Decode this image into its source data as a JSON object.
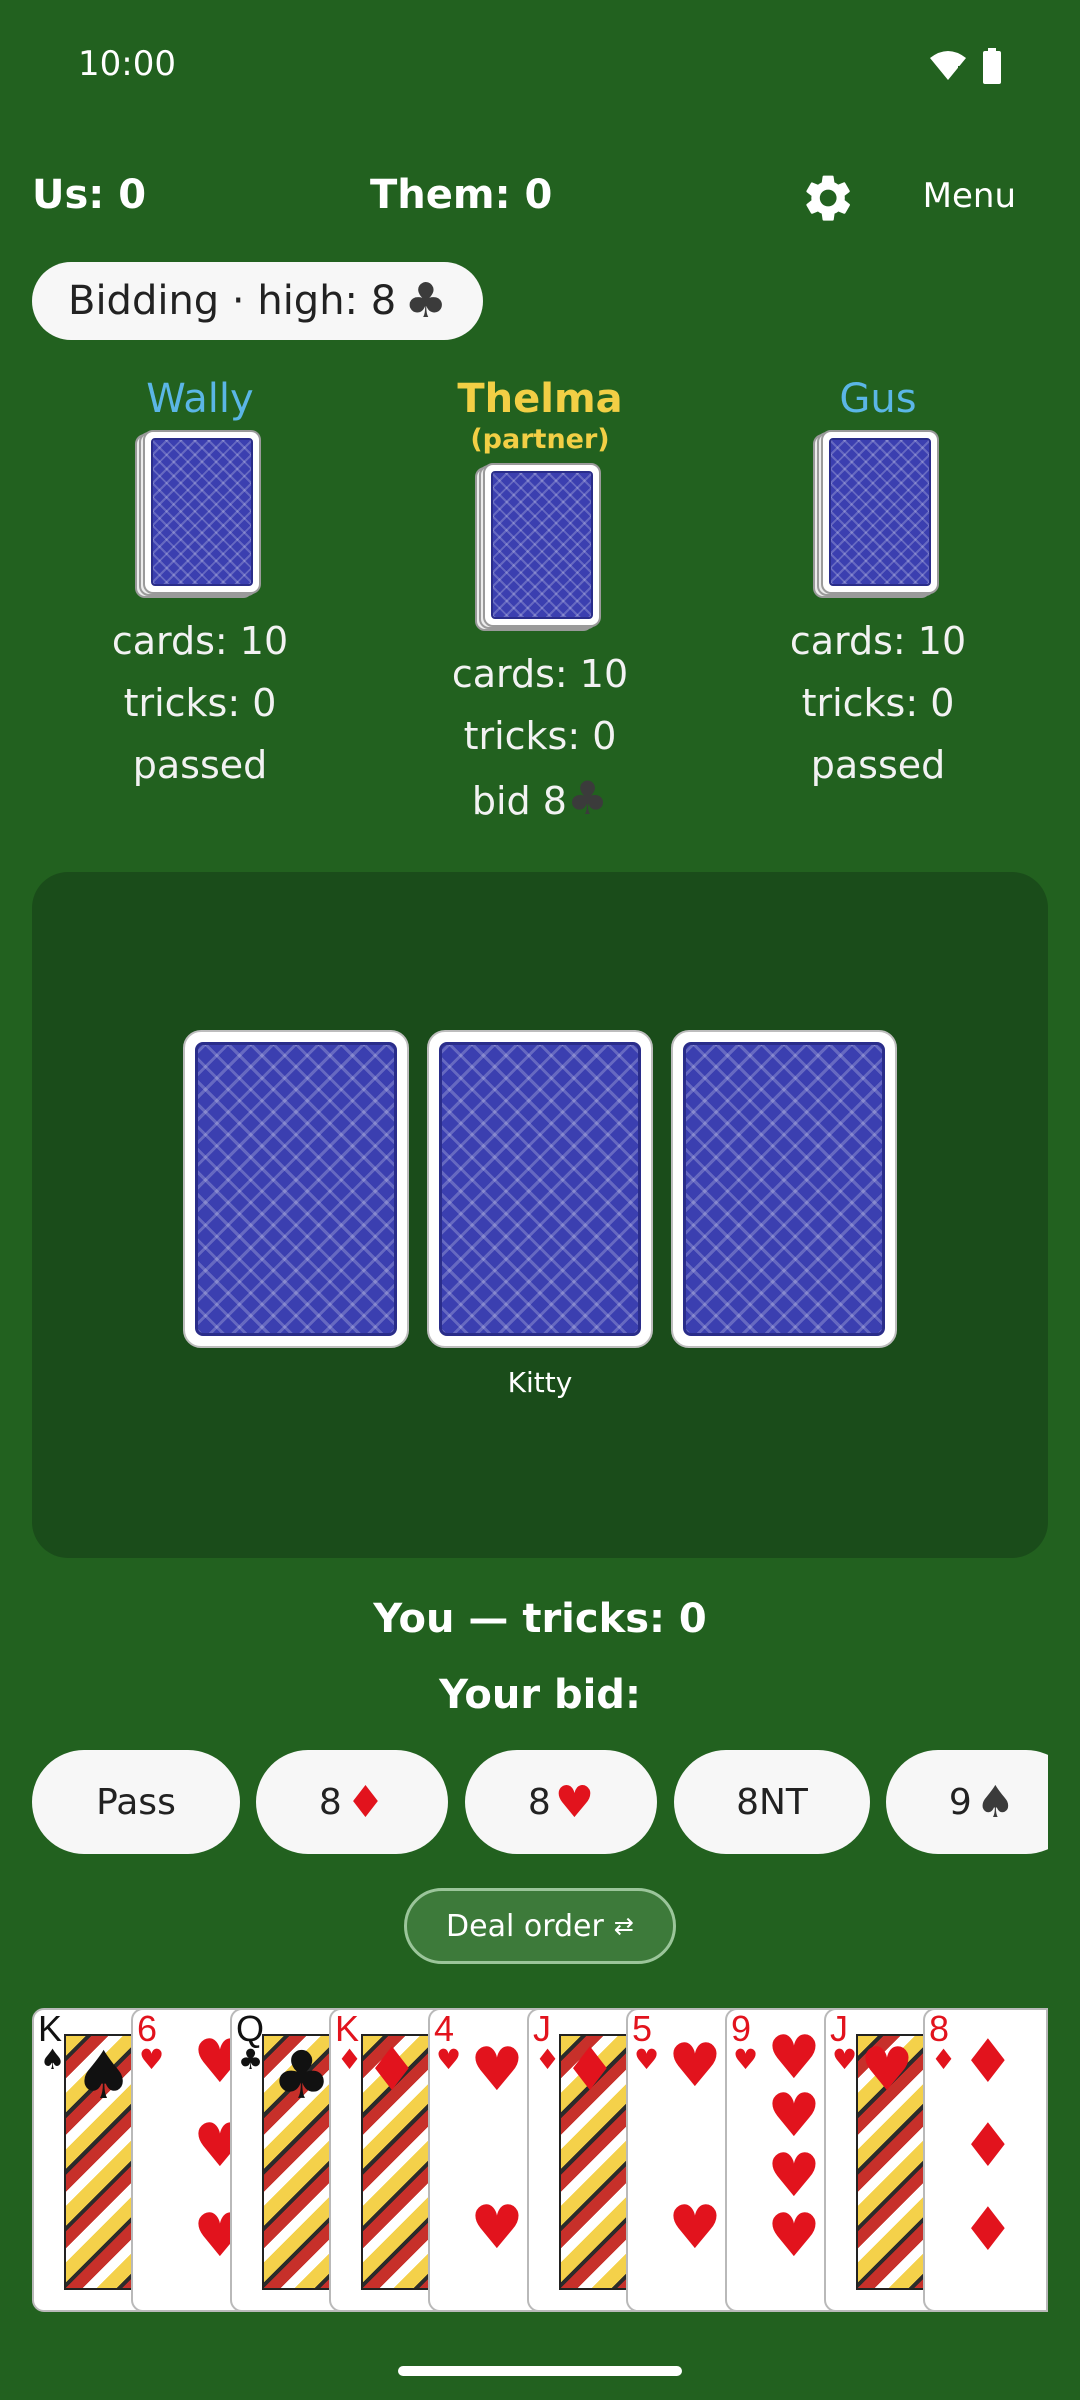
{
  "status_bar": {
    "time": "10:00"
  },
  "header": {
    "us": "Us: 0",
    "them": "Them: 0",
    "menu": "Menu"
  },
  "bidding": {
    "text": "Bidding · high: 8",
    "suit": "♣"
  },
  "players": [
    {
      "name": "Wally",
      "cards": "cards: 10",
      "tricks": "tricks: 0",
      "status": "passed"
    },
    {
      "name": "Thelma",
      "tag": "(partner)",
      "cards": "cards: 10",
      "tricks": "tricks: 0",
      "bid": "bid 8",
      "bid_suit": "♣"
    },
    {
      "name": "Gus",
      "cards": "cards: 10",
      "tricks": "tricks: 0",
      "status": "passed"
    }
  ],
  "kitty": {
    "label": "Kitty",
    "count": 3
  },
  "you": {
    "line": "You — tricks: 0",
    "prompt": "Your bid:"
  },
  "bid_options": [
    {
      "label": "Pass",
      "suit": ""
    },
    {
      "label": "8",
      "suit": "♦"
    },
    {
      "label": "8",
      "suit": "♥"
    },
    {
      "label": "8NT",
      "suit": ""
    },
    {
      "label": "9",
      "suit": "♠"
    }
  ],
  "deal_order": {
    "label": "Deal order",
    "icon": "⇄"
  },
  "hand": [
    {
      "rank": "K",
      "suit": "♠"
    },
    {
      "rank": "6",
      "suit": "♥"
    },
    {
      "rank": "Q",
      "suit": "♣"
    },
    {
      "rank": "K",
      "suit": "♦"
    },
    {
      "rank": "4",
      "suit": "♥"
    },
    {
      "rank": "J",
      "suit": "♦"
    },
    {
      "rank": "5",
      "suit": "♥"
    },
    {
      "rank": "9",
      "suit": "♥"
    },
    {
      "rank": "J",
      "suit": "♥"
    },
    {
      "rank": "8",
      "suit": "♦"
    }
  ],
  "colors": {
    "felt": "#22611f",
    "table": "#1a4c1a",
    "partner": "#f2cf45",
    "opponent": "#5bb6e6",
    "card_back": "#3b3fb0"
  }
}
